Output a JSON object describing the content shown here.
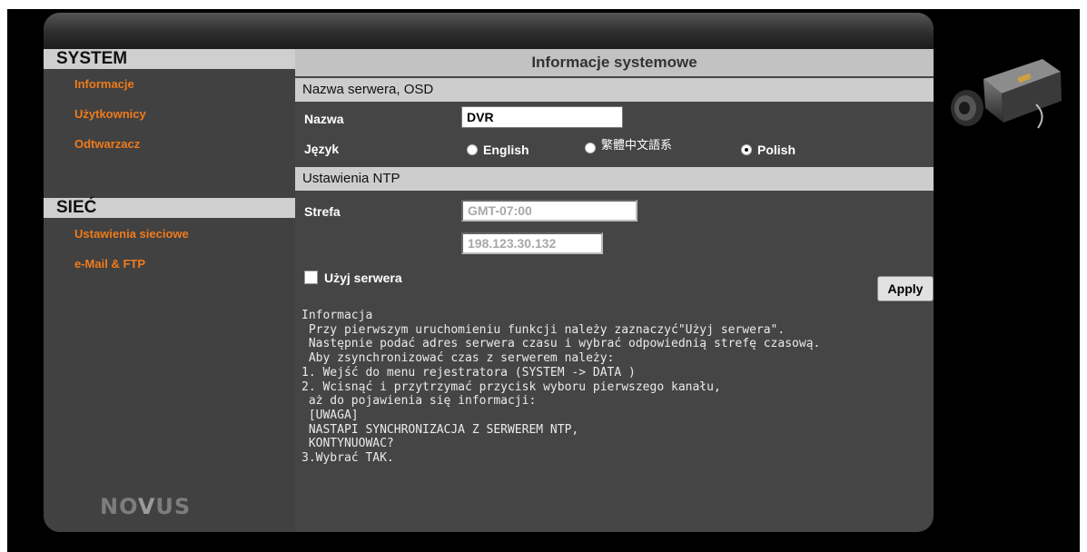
{
  "sidebar": {
    "system_heading": "SYSTEM",
    "system_items": [
      "Informacje",
      "Użytkownicy",
      "Odtwarzacz"
    ],
    "network_heading": "SIEĆ",
    "network_items": [
      "Ustawienia sieciowe",
      "e-Mail & FTP"
    ],
    "logo_text": [
      "NO",
      "V",
      "US"
    ]
  },
  "main": {
    "title": "Informacje systemowe",
    "server_section": {
      "heading": "Nazwa serwera, OSD",
      "name_label": "Nazwa",
      "name_value": "DVR",
      "language_label": "Język",
      "languages": [
        "English",
        "繁體中文語系",
        "Polish"
      ],
      "selected_language": "Polish"
    },
    "ntp_section": {
      "heading": "Ustawienia NTP",
      "zone_label": "Strefa",
      "zone_value": "GMT-07:00",
      "use_server_label": "Użyj serwera",
      "use_server_checked": false,
      "server_value": "198.123.30.132"
    },
    "apply_label": "Apply",
    "info_lines": [
      "Informacja",
      " Przy pierwszym uruchomieniu funkcji należy zaznaczyć\"Użyj serwera\".",
      " Następnie podać adres serwera czasu i wybrać odpowiednią strefę czasową.",
      " Aby zsynchronizować czas z serwerem należy:",
      "1. Wejść do menu rejestratora (SYSTEM -> DATA )",
      "2. Wcisnąć i przytrzymać przycisk wyboru pierwszego kanału,",
      " aż do pojawienia się informacji:",
      " [UWAGA]",
      " NASTAPI SYNCHRONIZACJA Z SERWEREM NTP,",
      " KONTYNUOWAC?",
      "3.Wybrać TAK."
    ]
  },
  "colors": {
    "accent": "#f07b1a",
    "panel": "#454545",
    "header": "#c2c2c2"
  }
}
